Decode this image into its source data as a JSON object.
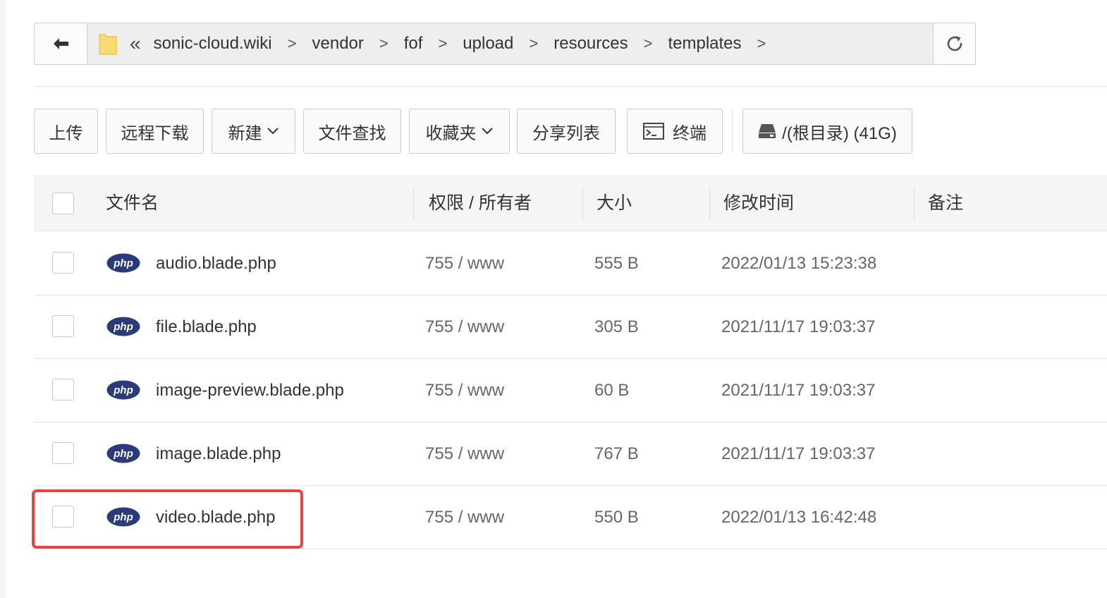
{
  "breadcrumb": {
    "items": [
      "sonic-cloud.wiki",
      "vendor",
      "fof",
      "upload",
      "resources",
      "templates"
    ],
    "collapse_glyph": "«",
    "separator": ">"
  },
  "toolbar": {
    "upload": "上传",
    "remote_download": "远程下载",
    "new": "新建",
    "find": "文件查找",
    "favorites": "收藏夹",
    "share_list": "分享列表",
    "terminal": "终端",
    "disk": "/(根目录) (41G)"
  },
  "table": {
    "headers": {
      "name": "文件名",
      "perm": "权限 / 所有者",
      "size": "大小",
      "mtime": "修改时间",
      "note": "备注"
    },
    "rows": [
      {
        "name": "audio.blade.php",
        "perm": "755 / www",
        "size": "555 B",
        "mtime": "2022/01/13 15:23:38"
      },
      {
        "name": "file.blade.php",
        "perm": "755 / www",
        "size": "305 B",
        "mtime": "2021/11/17 19:03:37"
      },
      {
        "name": "image-preview.blade.php",
        "perm": "755 / www",
        "size": "60 B",
        "mtime": "2021/11/17 19:03:37"
      },
      {
        "name": "image.blade.php",
        "perm": "755 / www",
        "size": "767 B",
        "mtime": "2021/11/17 19:03:37"
      },
      {
        "name": "video.blade.php",
        "perm": "755 / www",
        "size": "550 B",
        "mtime": "2022/01/13 16:42:48"
      }
    ]
  },
  "file_icon_text": "php",
  "icons": {
    "back": "arrow-left-icon",
    "folder": "folder-icon",
    "refresh": "refresh-icon",
    "terminal": "terminal-icon",
    "disk": "disk-icon",
    "file": "php-file-icon"
  },
  "colors": {
    "php_badge": "#2b3a7a",
    "highlight": "#e84343",
    "folder": "#f7dc6f"
  }
}
